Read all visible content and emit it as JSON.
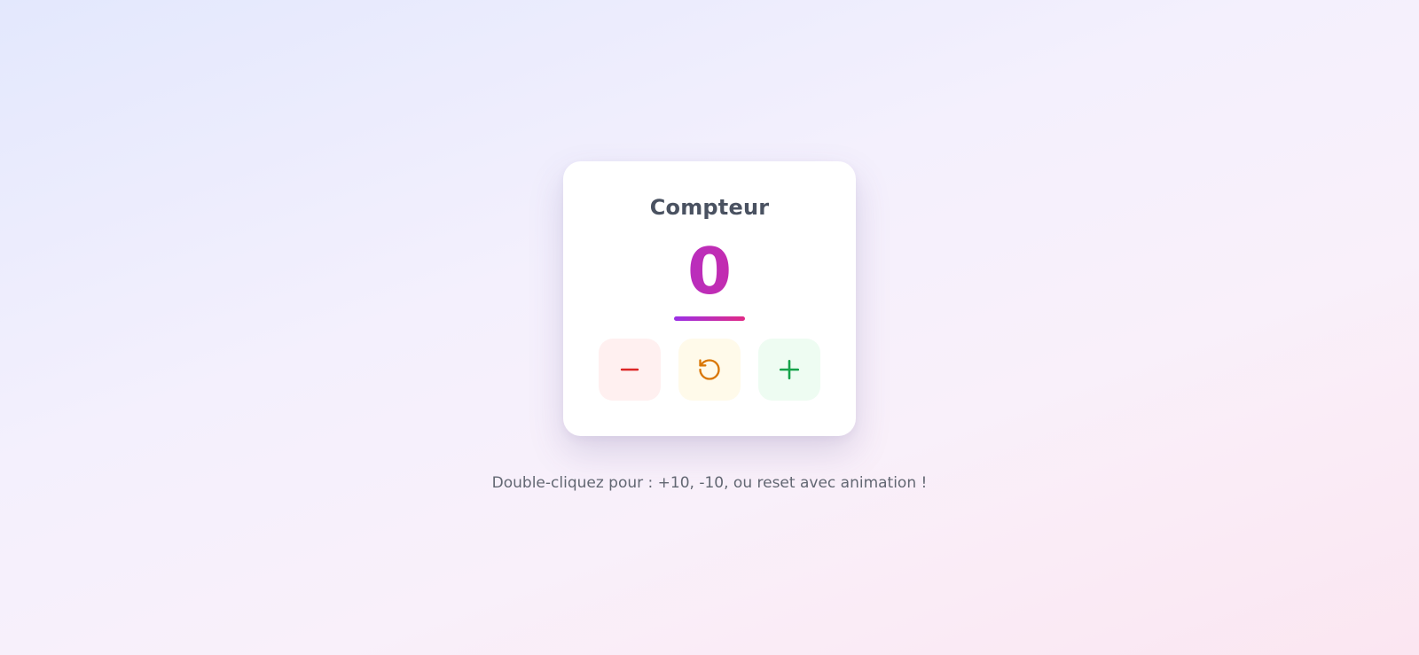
{
  "counter": {
    "title": "Compteur",
    "value": "0",
    "buttons": {
      "decrement_icon": "minus-icon",
      "reset_icon": "rotate-ccw-icon",
      "increment_icon": "plus-icon"
    }
  },
  "hint": "Double-cliquez pour : +10, -10, ou reset avec animation !",
  "colors": {
    "gradient_start": "#9b30e6",
    "gradient_end": "#e12a86",
    "minus": "#dc2626",
    "reset": "#d97706",
    "plus": "#16a34a"
  }
}
